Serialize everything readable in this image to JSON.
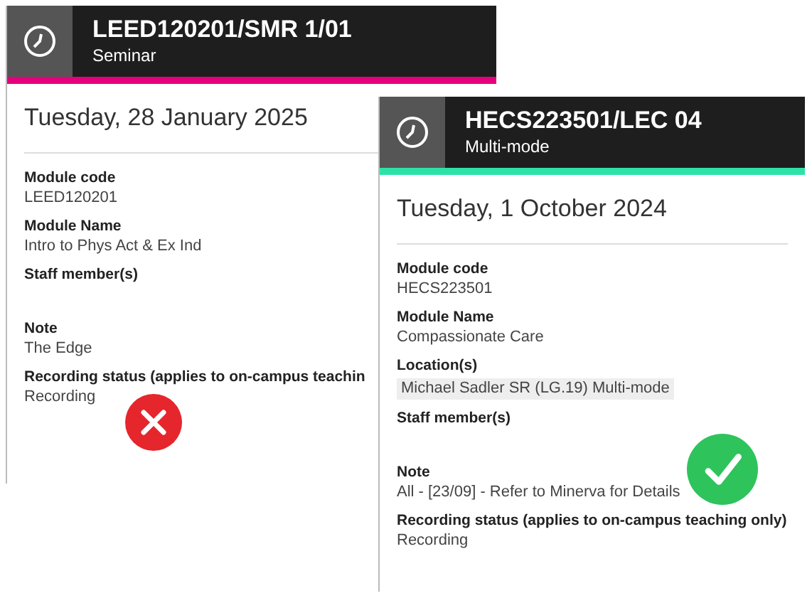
{
  "cards": [
    {
      "code": "LEED120201/SMR 1/01",
      "type": "Seminar",
      "color": "#e6007e",
      "date": "Tuesday, 28 January 2025",
      "kind": "cross",
      "fields": [
        {
          "label": "Module code",
          "value": "LEED120201"
        },
        {
          "label": "Module Name",
          "value": "Intro to Phys Act & Ex Ind"
        },
        {
          "label": "Staff member(s)"
        },
        {
          "label": "Note",
          "value": "The Edge"
        },
        {
          "label": "Recording status (applies to on-campus teachin",
          "value": "Recording"
        }
      ]
    },
    {
      "code": "HECS223501/LEC 04",
      "type": "Multi-mode",
      "color": "#2de2a8",
      "date": "Tuesday, 1 October 2024",
      "kind": "tick",
      "fields": [
        {
          "label": "Module code",
          "value": "HECS223501"
        },
        {
          "label": "Module Name",
          "value": "Compassionate Care"
        },
        {
          "label": "Location(s)",
          "value": "Michael Sadler SR (LG.19) Multi-mode",
          "kind": "chip"
        },
        {
          "label": "Staff member(s)"
        },
        {
          "label": "Note",
          "value": "All - [23/09] - Refer to Minerva for Details"
        },
        {
          "label": "Recording status (applies to on-campus teaching only)",
          "value": "Recording"
        }
      ]
    }
  ]
}
